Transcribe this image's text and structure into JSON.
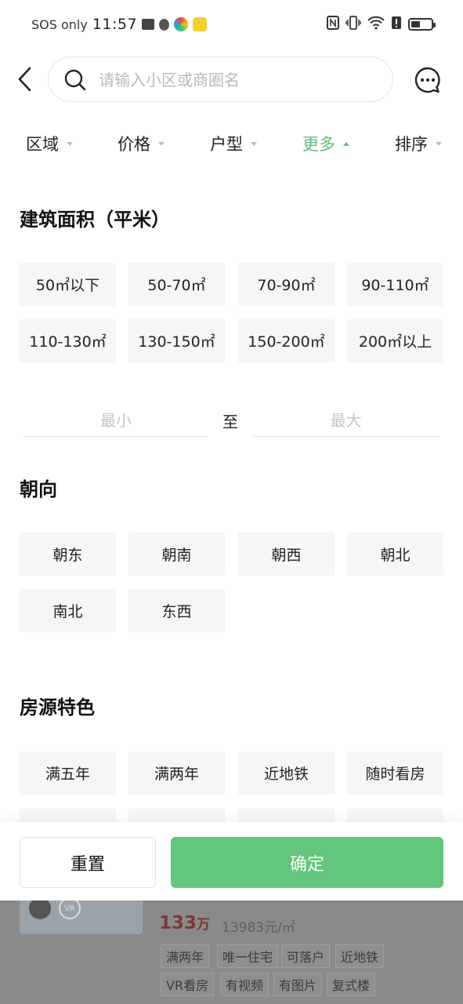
{
  "status_bar": {
    "carrier": "SOS only",
    "time": "11:57",
    "icons": [
      "mail-icon",
      "shield-icon",
      "app-icon",
      "app-icon",
      "nfc-icon",
      "vibrate-icon",
      "wifi-icon",
      "alert-icon",
      "battery-icon"
    ],
    "battery_level": 0.45
  },
  "header": {
    "back_icon": "chevron-left-icon",
    "search_placeholder": "请输入小区或商圈名",
    "message_icon": "chat-bubble-icon"
  },
  "tabs": [
    {
      "label": "区域",
      "active": false
    },
    {
      "label": "价格",
      "active": false
    },
    {
      "label": "户型",
      "active": false
    },
    {
      "label": "更多",
      "active": true
    },
    {
      "label": "排序",
      "active": false
    }
  ],
  "area": {
    "title": "建筑面积（平米）",
    "options": [
      "50㎡以下",
      "50-70㎡",
      "70-90㎡",
      "90-110㎡",
      "110-130㎡",
      "130-150㎡",
      "150-200㎡",
      "200㎡以上"
    ],
    "min_placeholder": "最小",
    "to_label": "至",
    "max_placeholder": "最大"
  },
  "orientation": {
    "title": "朝向",
    "options": [
      "朝东",
      "朝南",
      "朝西",
      "朝北",
      "南北",
      "东西"
    ]
  },
  "features": {
    "title": "房源特色",
    "options": [
      "满五年",
      "满两年",
      "近地铁",
      "随时看房"
    ]
  },
  "background_listing": {
    "price": "133",
    "price_unit": "万",
    "unit_price": "13983元/㎡",
    "tags": [
      "满两年",
      "唯一住宅",
      "可落户",
      "近地铁",
      "VR看房",
      "有视频",
      "有图片",
      "复式楼"
    ]
  },
  "actions": {
    "reset": "重置",
    "confirm": "确定"
  },
  "colors": {
    "accent": "#5dbf78",
    "confirm_button": "#63c67d",
    "chip_bg": "#f6f6f4"
  }
}
